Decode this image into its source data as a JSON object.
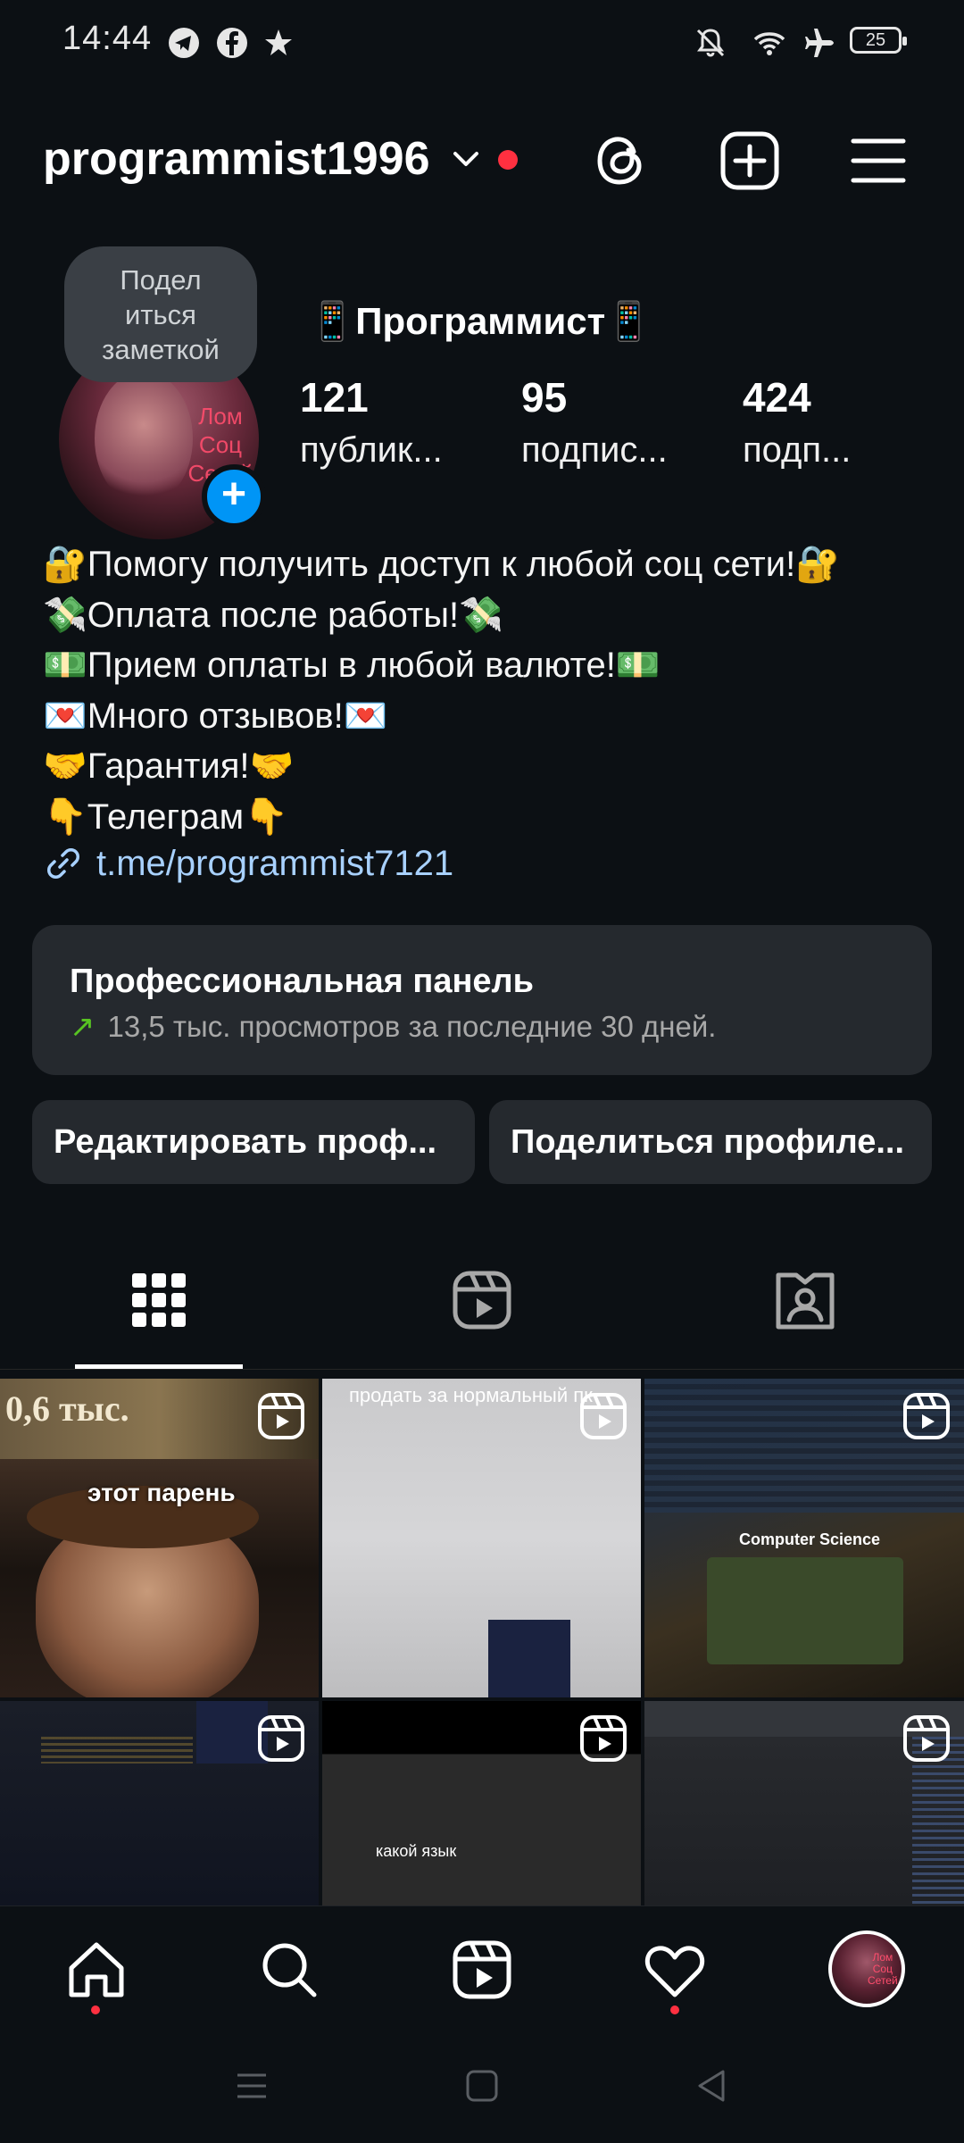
{
  "status_bar": {
    "time": "14:44",
    "battery": "25",
    "icons": [
      "telegram-icon",
      "facebook-icon",
      "star-icon",
      "mute-vibrate-icon",
      "wifi-icon",
      "airplane-icon",
      "battery-icon"
    ]
  },
  "header": {
    "username": "programmist1996",
    "icons": [
      "chevron-down-icon",
      "threads-icon",
      "add-post-icon",
      "menu-icon"
    ]
  },
  "profile": {
    "note_bubble": "Подел\nиться\nзаметкой",
    "avatar_text": "Лом\nСоц\nСетей",
    "display_name": "📱Программист📱",
    "stats": [
      {
        "value": "121",
        "label": "публик..."
      },
      {
        "value": "95",
        "label": "подпис..."
      },
      {
        "value": "424",
        "label": "подп..."
      }
    ],
    "bio_lines": [
      "🔐Помогу получить доступ к любой соц сети!🔐",
      "💸Оплата после работы!💸",
      "💵Прием оплаты в любой валюте!💵",
      "💌Много отзывов!💌",
      "🤝Гарантия!🤝",
      "👇Телеграм👇"
    ],
    "link": "t.me/programmist7121"
  },
  "pro_panel": {
    "title": "Профессиональная панель",
    "subtitle": "13,5 тыс. просмотров за последние 30 дней."
  },
  "actions": {
    "edit": "Редактировать проф...",
    "share": "Поделиться профиле..."
  },
  "tabs": [
    "grid-icon",
    "reels-icon",
    "tagged-icon"
  ],
  "grid": {
    "tile1_caption": "этот парень",
    "tile1_top_text": "0,6 тыс.",
    "tile2_caption": "продать за нормальный пк",
    "tile3_caption": "Computer Science",
    "tile5_caption": "какой  язык"
  },
  "bottom_nav": [
    "home-icon",
    "search-icon",
    "reels-icon",
    "heart-icon",
    "profile-avatar"
  ],
  "colors": {
    "background": "#0c1014",
    "card": "#25292e",
    "accent_blue": "#0095f6",
    "notification_red": "#ff3040",
    "link": "#a8d1ff",
    "trend_green": "#58c322"
  }
}
